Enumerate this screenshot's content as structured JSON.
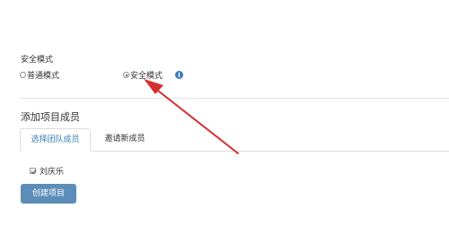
{
  "security_mode": {
    "label": "安全模式",
    "options": [
      {
        "label": "普通模式",
        "checked": false
      },
      {
        "label": "安全模式",
        "checked": true
      }
    ],
    "info_icon": "info-circle-icon"
  },
  "members": {
    "title": "添加项目成员",
    "tabs": [
      {
        "label": "选择团队成员",
        "active": true
      },
      {
        "label": "邀请新成员",
        "active": false
      }
    ],
    "list": [
      {
        "name": "刘庆乐",
        "checked": true
      }
    ]
  },
  "actions": {
    "create_label": "创建项目"
  },
  "annotation": {
    "icon": "red-arrow-annotation",
    "color": "#d32f2f"
  },
  "colors": {
    "primary_button": "#5b8db8",
    "active_tab_text": "#3a7cb8",
    "info_icon": "#3a7cb8"
  }
}
